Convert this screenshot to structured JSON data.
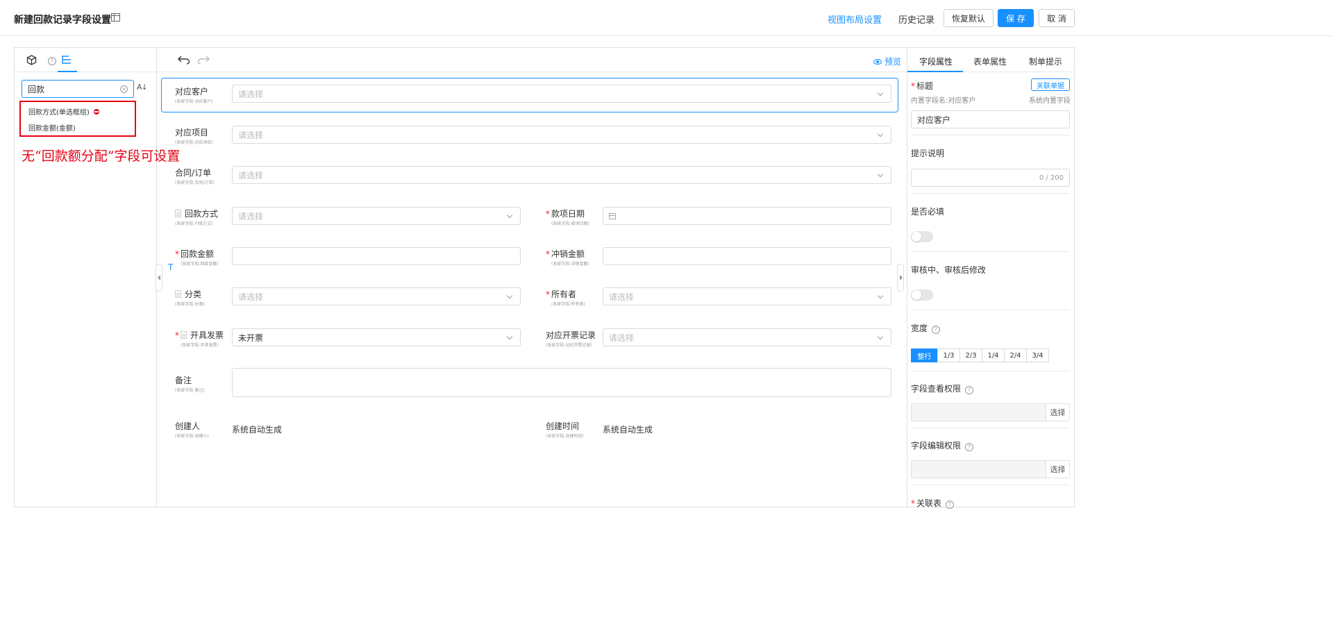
{
  "header": {
    "title": "新建回款记录字段设置",
    "view_layout": "视图布局设置",
    "history": "历史记录",
    "restore": "恢复默认",
    "save": "保 存",
    "cancel": "取 消"
  },
  "colors": {
    "accent": "#1890ff",
    "required": "#f5222d",
    "annotation": "#e60012"
  },
  "left": {
    "search_value": "回款",
    "results": [
      "回款方式(单选框组)",
      "回款金额(金额)"
    ],
    "annotation": "无“回款额分配”字段可设置"
  },
  "center": {
    "preview": "预览",
    "text_marker": "T",
    "placeholder": "请选择",
    "fields": {
      "customer": {
        "label": "对应客户",
        "sub": "(系统字段-对应客户)"
      },
      "project": {
        "label": "对应项目",
        "sub": "(系统字段-对应项目)"
      },
      "contract": {
        "label": "合同/订单",
        "sub": "(系统字段-合同/订单)"
      },
      "pay_method": {
        "label": "回款方式",
        "sub": "(系统字段-付款方式)"
      },
      "pay_date": {
        "label": "款项日期",
        "sub": "(系统字段-款项日期)"
      },
      "amount": {
        "label": "回款金额",
        "sub": "(系统字段-回款金额)"
      },
      "offset": {
        "label": "冲销金额",
        "sub": "(系统字段-冲销金额)"
      },
      "category": {
        "label": "分类",
        "sub": "(系统字段-分类)"
      },
      "owner": {
        "label": "所有者",
        "sub": "(系统字段-所有者)"
      },
      "invoice": {
        "label": "开具发票",
        "sub": "(系统字段-开具发票)",
        "value": "未开票"
      },
      "invoice_rec": {
        "label": "对应开票记录",
        "sub": "(系统字段-对应开票记录)"
      },
      "remark": {
        "label": "备注",
        "sub": "(系统字段-备注)"
      },
      "creator": {
        "label": "创建人",
        "sub": "(系统字段-创建人)",
        "value": "系统自动生成"
      },
      "created_at": {
        "label": "创建时间",
        "sub": "(系统字段-创建时间)",
        "value": "系统自动生成"
      }
    }
  },
  "right": {
    "tabs": [
      "字段属性",
      "表单属性",
      "制单提示"
    ],
    "title_label": "标题",
    "link_btn": "关联单据",
    "builtin_name": "内置字段名:对应客户",
    "system_field": "系统内置字段",
    "title_value": "对应客户",
    "hint_label": "提示说明",
    "hint_count": "0 / 200",
    "required_label": "是否必填",
    "audit_label": "审核中、审核后修改",
    "width_label": "宽度",
    "width_options": [
      "整行",
      "1/3",
      "2/3",
      "1/4",
      "2/4",
      "3/4"
    ],
    "view_perm": "字段查看权限",
    "edit_perm": "字段编辑权限",
    "select": "选择",
    "related": "关联表"
  }
}
